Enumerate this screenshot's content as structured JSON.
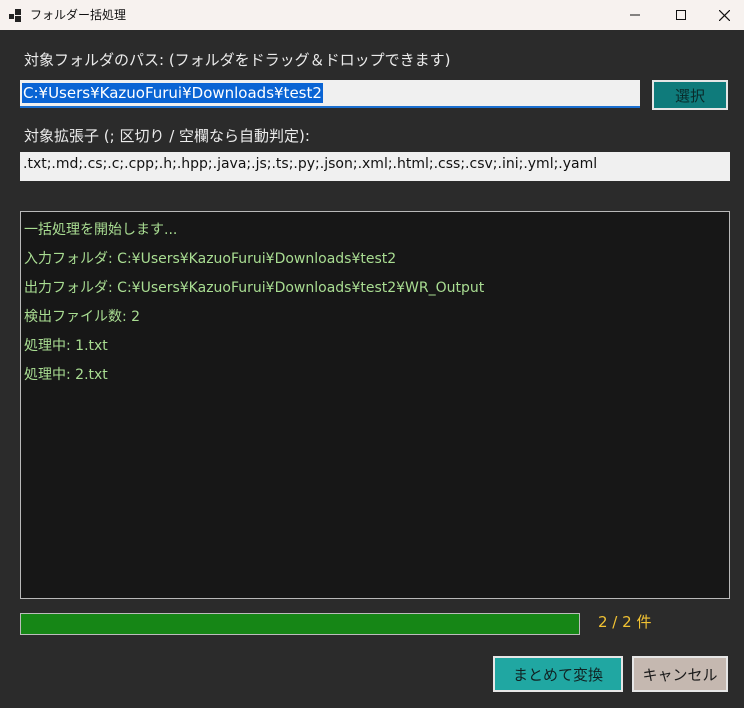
{
  "window": {
    "title": "フォルダー括処理"
  },
  "folder": {
    "label": "対象フォルダのパス: (フォルダをドラッグ＆ドロップできます)",
    "value": "C:¥Users¥KazuoFurui¥Downloads¥test2",
    "select_label": "選択"
  },
  "extensions": {
    "label": "対象拡張子 (; 区切り / 空欄なら自動判定):",
    "value": ".txt;.md;.cs;.c;.cpp;.h;.hpp;.java;.js;.ts;.py;.json;.xml;.html;.css;.csv;.ini;.yml;.yaml"
  },
  "log": {
    "lines": [
      "一括処理を開始します...",
      "入力フォルダ: C:¥Users¥KazuoFurui¥Downloads¥test2",
      "出力フォルダ: C:¥Users¥KazuoFurui¥Downloads¥test2¥WR_Output",
      "検出ファイル数: 2",
      "処理中: 1.txt",
      "処理中: 2.txt"
    ]
  },
  "progress": {
    "fraction": 1.0,
    "text": "2 / 2 件"
  },
  "actions": {
    "convert_label": "まとめて変換",
    "cancel_label": "キャンセル"
  },
  "colors": {
    "background": "#2b2b2b",
    "log_text": "#a9dd92",
    "progress_fill": "#168616",
    "progress_text": "#f1c233",
    "accent_button": "#20a7a2",
    "select_button": "#0f7b7b"
  }
}
